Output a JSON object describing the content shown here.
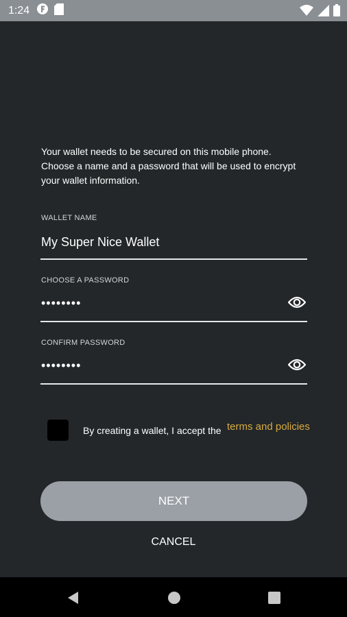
{
  "status_bar": {
    "time": "1:24",
    "left_icons": [
      "app-f-icon",
      "sd-card-icon"
    ],
    "right_icons": [
      "wifi-icon",
      "signal-icon",
      "battery-icon"
    ]
  },
  "intro": {
    "text": "Your wallet needs to be secured on this mobile phone. Choose a name and a password that will be used to encrypt your wallet information."
  },
  "wallet_name": {
    "label": "WALLET NAME",
    "value": "My Super Nice Wallet"
  },
  "password": {
    "label": "CHOOSE A PASSWORD",
    "value": "••••••••",
    "icon": "eye-icon"
  },
  "confirm_password": {
    "label": "CONFIRM PASSWORD",
    "value": "••••••••",
    "icon": "eye-icon"
  },
  "terms": {
    "text": "By creating a wallet, I accept the",
    "link": "terms and policies",
    "checked": false,
    "link_color": "#d8ab3f"
  },
  "actions": {
    "next": "NEXT",
    "cancel": "CANCEL"
  },
  "nav_bar": {
    "buttons": [
      "back-icon",
      "home-icon",
      "recents-icon"
    ]
  },
  "colors": {
    "background": "#23272a",
    "status_bar": "#8a8f93",
    "button": "#9aa0a6"
  }
}
